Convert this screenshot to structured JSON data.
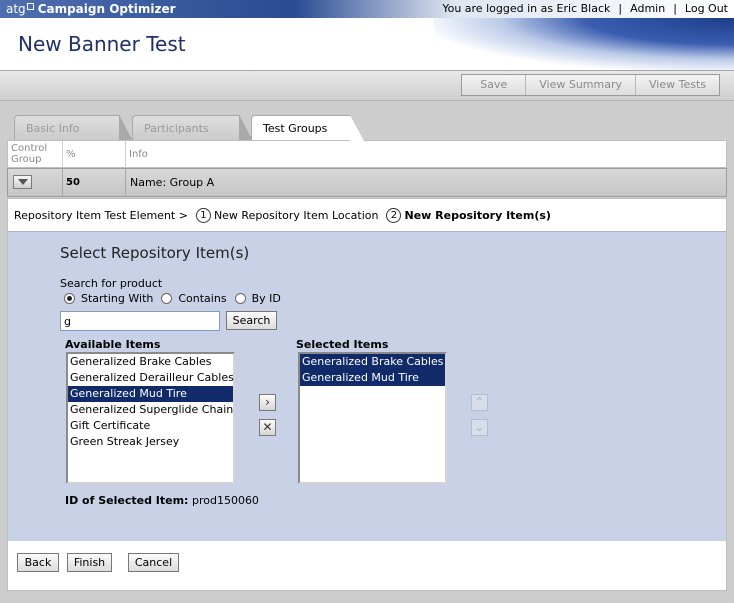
{
  "app": {
    "brand": "atg",
    "name": "Campaign Optimizer"
  },
  "userbar": {
    "logged_in": "You are logged in as Eric Black",
    "admin": "Admin",
    "logout": "Log Out",
    "sep": "|"
  },
  "page": {
    "title": "New Banner Test"
  },
  "toolbar": {
    "save": "Save",
    "view_summary": "View Summary",
    "view_tests": "View Tests"
  },
  "tabs": [
    {
      "label": "Basic Info",
      "active": false
    },
    {
      "label": "Participants",
      "active": false
    },
    {
      "label": "Test Groups",
      "active": true
    }
  ],
  "group_table": {
    "headers": [
      "Control Group",
      "%",
      "Info"
    ],
    "row": {
      "percent": "50",
      "info": "Name: Group A"
    }
  },
  "breadcrumb": {
    "root": "Repository Item Test Element >",
    "step1_num": "1",
    "step1": "New Repository Item Location",
    "step2_num": "2",
    "step2": "New Repository Item(s)"
  },
  "select": {
    "title": "Select Repository Item(s)",
    "search_label": "Search for product",
    "radio_options": [
      "Starting With",
      "Contains",
      "By ID"
    ],
    "radio_selected": "Starting With",
    "search_value": "g",
    "search_button": "Search",
    "available_header": "Available Items",
    "available_items": [
      "Generalized Brake Cables",
      "Generalized Derailleur Cables",
      "Generalized Mud Tire",
      "Generalized Superglide Chain",
      "Gift Certificate",
      "Green Streak Jersey"
    ],
    "available_selected": "Generalized Mud Tire",
    "selected_header": "Selected Items",
    "selected_items": [
      "Generalized Brake Cables",
      "Generalized Mud Tire"
    ],
    "id_label": "ID of Selected Item:",
    "id_value": "prod150060"
  },
  "footer": {
    "back": "Back",
    "finish": "Finish",
    "cancel": "Cancel"
  },
  "icons": {
    "add": "chevron-right-icon",
    "remove": "close-icon",
    "up": "chevron-up-icon",
    "down": "chevron-down-icon",
    "dropdown": "triangle-down-icon"
  },
  "colors": {
    "brand_blue": "#1f2f6a",
    "selection": "#102a6a",
    "panel": "#c8d1e6"
  }
}
